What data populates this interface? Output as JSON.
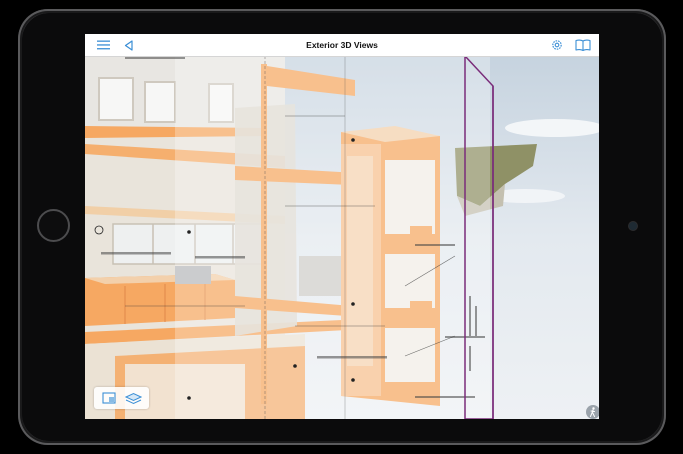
{
  "navbar": {
    "title": "Exterior 3D Views",
    "left_icons": [
      "menu-icon",
      "back-arrow-icon"
    ],
    "right_icons": [
      "settings-gear-icon",
      "book-icon"
    ]
  },
  "viewport": {
    "content": "3d-building-section-model",
    "accent_color": "#f6a862",
    "frame_color": "#7a2c7a",
    "sky_color": "#dfe6ed"
  },
  "toolbar": {
    "icons": [
      "sheet-view-icon",
      "layers-3d-icon"
    ]
  },
  "corner": {
    "icon": "walk-person-icon"
  }
}
